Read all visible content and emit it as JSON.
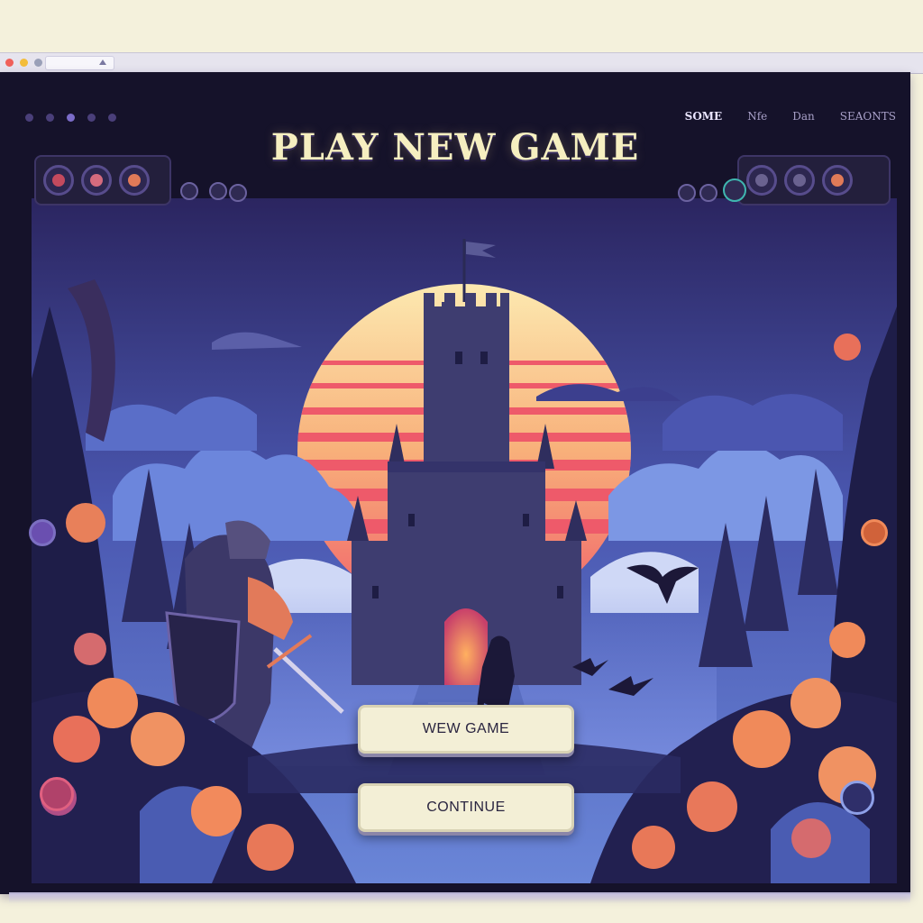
{
  "browser": {
    "window_buttons": [
      {
        "name": "close",
        "color": "#f0605a"
      },
      {
        "name": "minimize",
        "color": "#f3bd3a"
      },
      {
        "name": "maximize",
        "color": "#9aa0b8"
      }
    ]
  },
  "header": {
    "title": "PLAY NEW GAME",
    "nav": [
      "SOME",
      "Nfe",
      "Dan",
      "SEAONTS"
    ]
  },
  "menu": {
    "new_game": "WEW GAME",
    "continue": "CONTINUE"
  },
  "colors": {
    "title": "#f6efc0",
    "sun": "#fbe0a0",
    "sun_stripe": "#ef5f68",
    "sky": "#5b74c8",
    "castle": "#3e3d70",
    "gate_glow": "#f07a48",
    "foliage": "#2a2a5a",
    "flowers": "#f08a5a",
    "button_bg": "#f3efd6"
  },
  "icons": {
    "left_panel": [
      "red-gear-icon",
      "crossed-swords-icon",
      "shield-icon"
    ],
    "right_panel": [
      "slot-icon",
      "orb-icon",
      "fire-icon"
    ]
  }
}
